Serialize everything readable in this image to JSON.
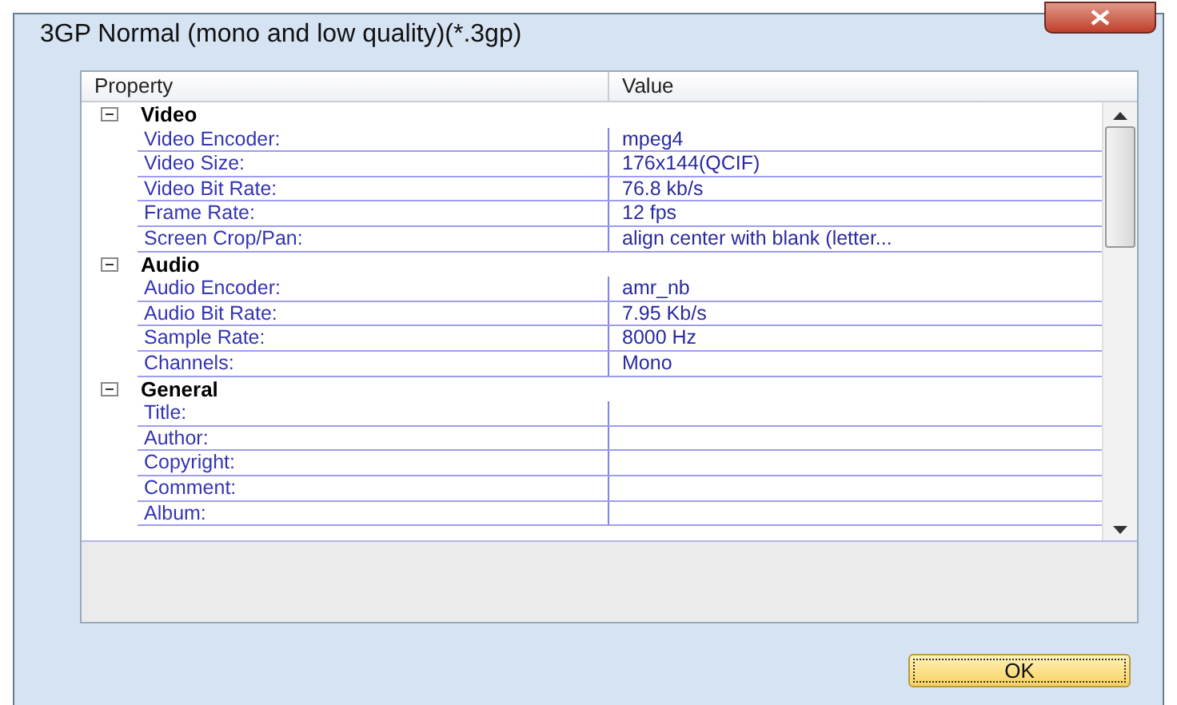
{
  "window": {
    "title": "3GP Normal (mono and low quality)(*.3gp)"
  },
  "grid": {
    "columns": [
      "Property",
      "Value"
    ],
    "sections": [
      {
        "name": "Video",
        "expanded": true,
        "rows": [
          {
            "property": "Video Encoder:",
            "value": "mpeg4"
          },
          {
            "property": "Video Size:",
            "value": "176x144(QCIF)"
          },
          {
            "property": "Video Bit Rate:",
            "value": "76.8 kb/s"
          },
          {
            "property": "Frame Rate:",
            "value": "12 fps"
          },
          {
            "property": "Screen Crop/Pan:",
            "value": "align center with blank (letter..."
          }
        ]
      },
      {
        "name": "Audio",
        "expanded": true,
        "rows": [
          {
            "property": "Audio Encoder:",
            "value": "amr_nb"
          },
          {
            "property": "Audio Bit Rate:",
            "value": "7.95 Kb/s"
          },
          {
            "property": "Sample Rate:",
            "value": "8000 Hz"
          },
          {
            "property": "Channels:",
            "value": "Mono"
          }
        ]
      },
      {
        "name": "General",
        "expanded": true,
        "rows": [
          {
            "property": "Title:"
          },
          {
            "property": "Author:"
          },
          {
            "property": "Copyright:"
          },
          {
            "property": "Comment:"
          },
          {
            "property": "Album:"
          }
        ]
      }
    ]
  },
  "buttons": [
    "OK"
  ]
}
